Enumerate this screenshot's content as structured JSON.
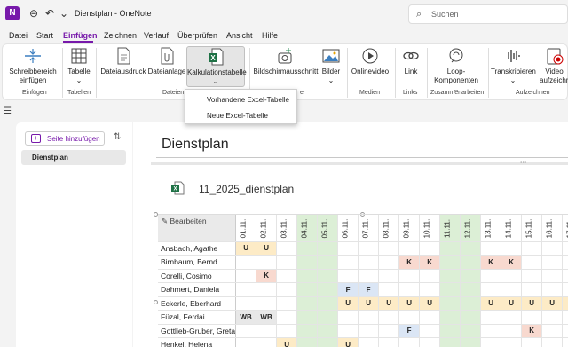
{
  "window": {
    "title": "Dienstplan - OneNote",
    "app_logo": "N"
  },
  "search": {
    "placeholder": "Suchen"
  },
  "menu": [
    "Datei",
    "Start",
    "Einfügen",
    "Zeichnen",
    "Verlauf",
    "Überprüfen",
    "Ansicht",
    "Hilfe"
  ],
  "menu_active": "Einfügen",
  "ribbon": {
    "buttons": {
      "schreibbereich": "Schreibbereich einfügen",
      "tabelle": "Tabelle",
      "dateiausdruck": "Dateiausdruck",
      "dateianlage": "Dateianlage",
      "kalkulationstabelle": "Kalkulationstabelle",
      "bildschirmausschnitt": "Bildschirmausschnitt",
      "bilder": "Bilder",
      "onlinevideo": "Onlinevideo",
      "link": "Link",
      "loop": "Loop-Komponenten",
      "transkribieren": "Transkribieren",
      "video_aufzeichnen": "Video aufzeichn"
    },
    "groups": {
      "einfuegen": "Einfügen",
      "tabellen": "Tabellen",
      "dateien": "Dateien",
      "bilder": "er",
      "medien": "Medien",
      "links": "Links",
      "zusammenarbeiten": "Zusammenarbeiten",
      "aufzeichnen": "Aufzeichnen"
    }
  },
  "dropdown": [
    "Vorhandene Excel-Tabelle",
    "Neue Excel-Tabelle"
  ],
  "left_pane": {
    "add_page": "Seite hinzufügen",
    "pages": [
      "Dienstplan"
    ]
  },
  "page": {
    "title": "Dienstplan",
    "file_name": "11_2025_dienstplan"
  },
  "sheet": {
    "edit_label": "Bearbeiten",
    "days": [
      "01.11.",
      "02.11.",
      "03.11.",
      "04.11.",
      "05.11.",
      "06.11.",
      "07.11.",
      "08.11.",
      "09.11.",
      "10.11.",
      "11.11.",
      "12.11.",
      "13.11.",
      "14.11.",
      "15.11.",
      "16.11.",
      "17.11.",
      "18.11.",
      "19.11.",
      "20.11."
    ],
    "weekend_columns": [
      3,
      4,
      10,
      11,
      17,
      18
    ],
    "rows": [
      {
        "name": "Ansbach, Agathe",
        "cells": [
          "U",
          "U",
          "",
          "",
          "",
          "",
          "",
          "",
          "",
          "",
          "",
          "",
          "",
          "",
          "",
          "",
          "",
          "",
          "",
          "F"
        ]
      },
      {
        "name": "Birnbaum, Bernd",
        "cells": [
          "",
          "",
          "",
          "",
          "",
          "",
          "",
          "",
          "K",
          "K",
          "",
          "",
          "K",
          "K",
          "",
          "",
          "",
          "",
          "",
          ""
        ]
      },
      {
        "name": "Corelli, Cosimo",
        "cells": [
          "",
          "K",
          "",
          "",
          "",
          "",
          "",
          "",
          "",
          "",
          "",
          "",
          "",
          "",
          "",
          "",
          "",
          "",
          "",
          ""
        ]
      },
      {
        "name": "Dahmert, Daniela",
        "cells": [
          "",
          "",
          "",
          "",
          "",
          "F",
          "F",
          "",
          "",
          "",
          "",
          "",
          "",
          "",
          "",
          "",
          "",
          "",
          "",
          ""
        ]
      },
      {
        "name": "Eckerle, Eberhard",
        "cells": [
          "",
          "",
          "",
          "",
          "",
          "U",
          "U",
          "U",
          "U",
          "U",
          "",
          "",
          "U",
          "U",
          "U",
          "U",
          "U",
          "",
          "",
          "U"
        ]
      },
      {
        "name": "Füzal, Ferdai",
        "cells": [
          "WB",
          "WB",
          "",
          "",
          "",
          "",
          "",
          "",
          "",
          "",
          "",
          "",
          "",
          "",
          "",
          "",
          "",
          "",
          "",
          ""
        ]
      },
      {
        "name": "Gottlieb-Gruber, Greta",
        "cells": [
          "",
          "",
          "",
          "",
          "",
          "",
          "",
          "",
          "F",
          "",
          "",
          "",
          "",
          "",
          "K",
          "",
          "",
          "",
          "",
          ""
        ]
      },
      {
        "name": "Henkel, Helena",
        "cells": [
          "",
          "",
          "U",
          "",
          "",
          "U",
          "",
          "",
          "",
          "",
          "",
          "",
          "",
          "",
          "",
          "",
          "",
          "",
          "",
          ""
        ]
      }
    ]
  }
}
